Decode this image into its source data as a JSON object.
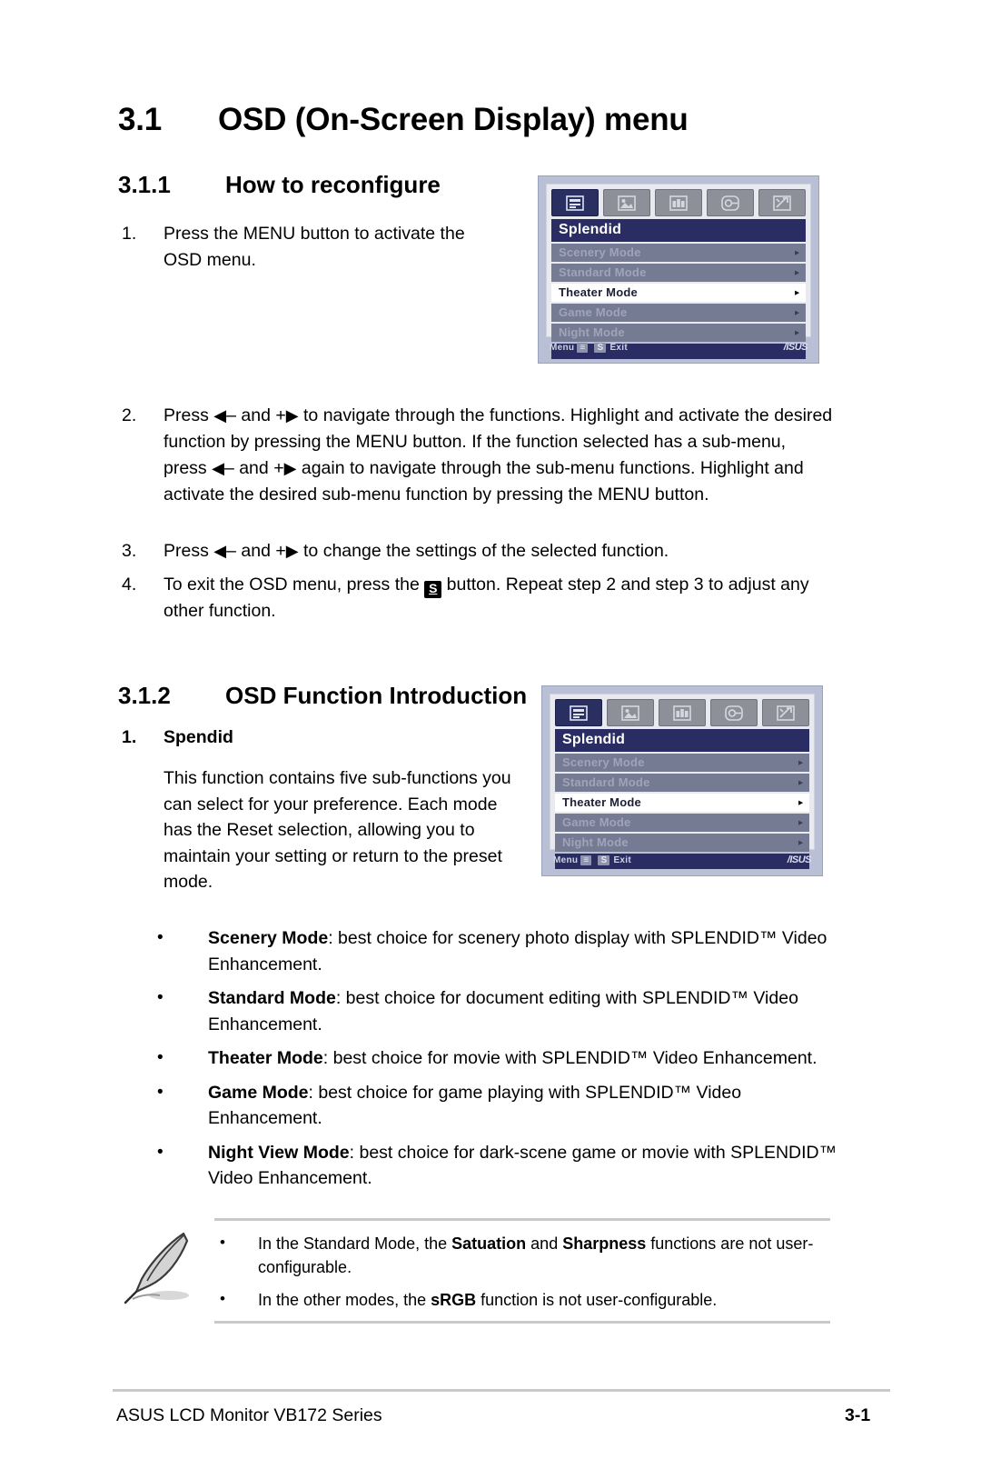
{
  "headings": {
    "h1_num": "3.1",
    "h1_text": "OSD (On-Screen Display) menu",
    "h2a_num": "3.1.1",
    "h2a_text": "How to reconfigure",
    "h2b_num": "3.1.2",
    "h2b_text": "OSD Function Introduction"
  },
  "steps": [
    {
      "marker": "1.",
      "pre": "Press the MENU button to activate the OSD menu.",
      "post": ""
    },
    {
      "marker": "2.",
      "p1": "Press",
      "p2": "– and",
      "p3": "+",
      "p4": "to navigate through the functions. Highlight and activate the desired function by pressing the MENU button. If the function selected has a sub-menu, press",
      "p5": "– and",
      "p6": "+",
      "p7": "again to navigate through the sub-menu functions. Highlight and activate the desired sub-menu function by pressing the MENU button."
    },
    {
      "marker": "3.",
      "p1": "Press",
      "p2": "– and",
      "p3": "+",
      "p4": "to change the settings of the selected function."
    },
    {
      "marker": "4.",
      "p1": "To exit the OSD menu, press the",
      "button_label": "S",
      "p2": "button. Repeat step 2 and step 3 to adjust any other function."
    }
  ],
  "splendid_section": {
    "item_num": "1.",
    "item_title": "Spendid",
    "paragraph": "This function contains five sub-functions you can select for your preference. Each mode has the Reset selection, allowing you to maintain your setting or return to the preset mode."
  },
  "mode_bullets": [
    {
      "bullet": "•",
      "name": "Scenery Mode",
      "text": ": best choice for scenery photo display with SPLENDID™ Video Enhancement."
    },
    {
      "bullet": "•",
      "name": "Standard Mode",
      "text": ": best choice for document editing with SPLENDID™ Video Enhancement."
    },
    {
      "bullet": "•",
      "name": "Theater Mode",
      "text": ": best choice for movie with SPLENDID™ Video Enhancement."
    },
    {
      "bullet": "•",
      "name": "Game Mode",
      "text": ": best choice for game playing with SPLENDID™ Video Enhancement."
    },
    {
      "bullet": "•",
      "name": "Night View Mode",
      "text": ": best choice for dark-scene game or movie with SPLENDID™ Video Enhancement."
    }
  ],
  "note": {
    "icon": "quill-pen-icon",
    "items": [
      {
        "bullet": "•",
        "part1": "In the Standard Mode, the ",
        "bold1": "Satuation",
        "part2": " and ",
        "bold2": "Sharpness",
        "part3": " functions are not user-configurable."
      },
      {
        "bullet": "•",
        "part1": "In the other modes, the ",
        "bold1": "sRGB",
        "part2": " function is not user-configurable.",
        "bold2": "",
        "part3": ""
      }
    ]
  },
  "footer": {
    "left": "ASUS LCD Monitor VB172 Series",
    "page": "3-1"
  },
  "osd": {
    "title": "Splendid",
    "tabs": [
      {
        "name": "splendid-tab",
        "active": true
      },
      {
        "name": "image-tab",
        "active": false
      },
      {
        "name": "color-tab",
        "active": false
      },
      {
        "name": "input-select-tab",
        "active": false
      },
      {
        "name": "system-setup-tab",
        "active": false
      }
    ],
    "rows": [
      {
        "label": "Scenery Mode",
        "selected": false,
        "arrow": "▸"
      },
      {
        "label": "Standard Mode",
        "selected": false,
        "arrow": "▸"
      },
      {
        "label": "Theater Mode",
        "selected": true,
        "arrow": "▸"
      },
      {
        "label": "Game Mode",
        "selected": false,
        "arrow": "▸"
      },
      {
        "label": "Night Mode",
        "selected": false,
        "arrow": "▸"
      }
    ],
    "bottom": {
      "menu_label": "Menu",
      "menu_key": "≡",
      "exit_key": "S",
      "exit_label": "Exit",
      "logo": "/ISUS"
    },
    "colors": {
      "panel_bg": "#b9c0d6",
      "title_bar": "#2a2d63",
      "row_bg": "#767b94",
      "selected_bg": "#ffffff",
      "active_tab": "#2a2f62"
    }
  }
}
